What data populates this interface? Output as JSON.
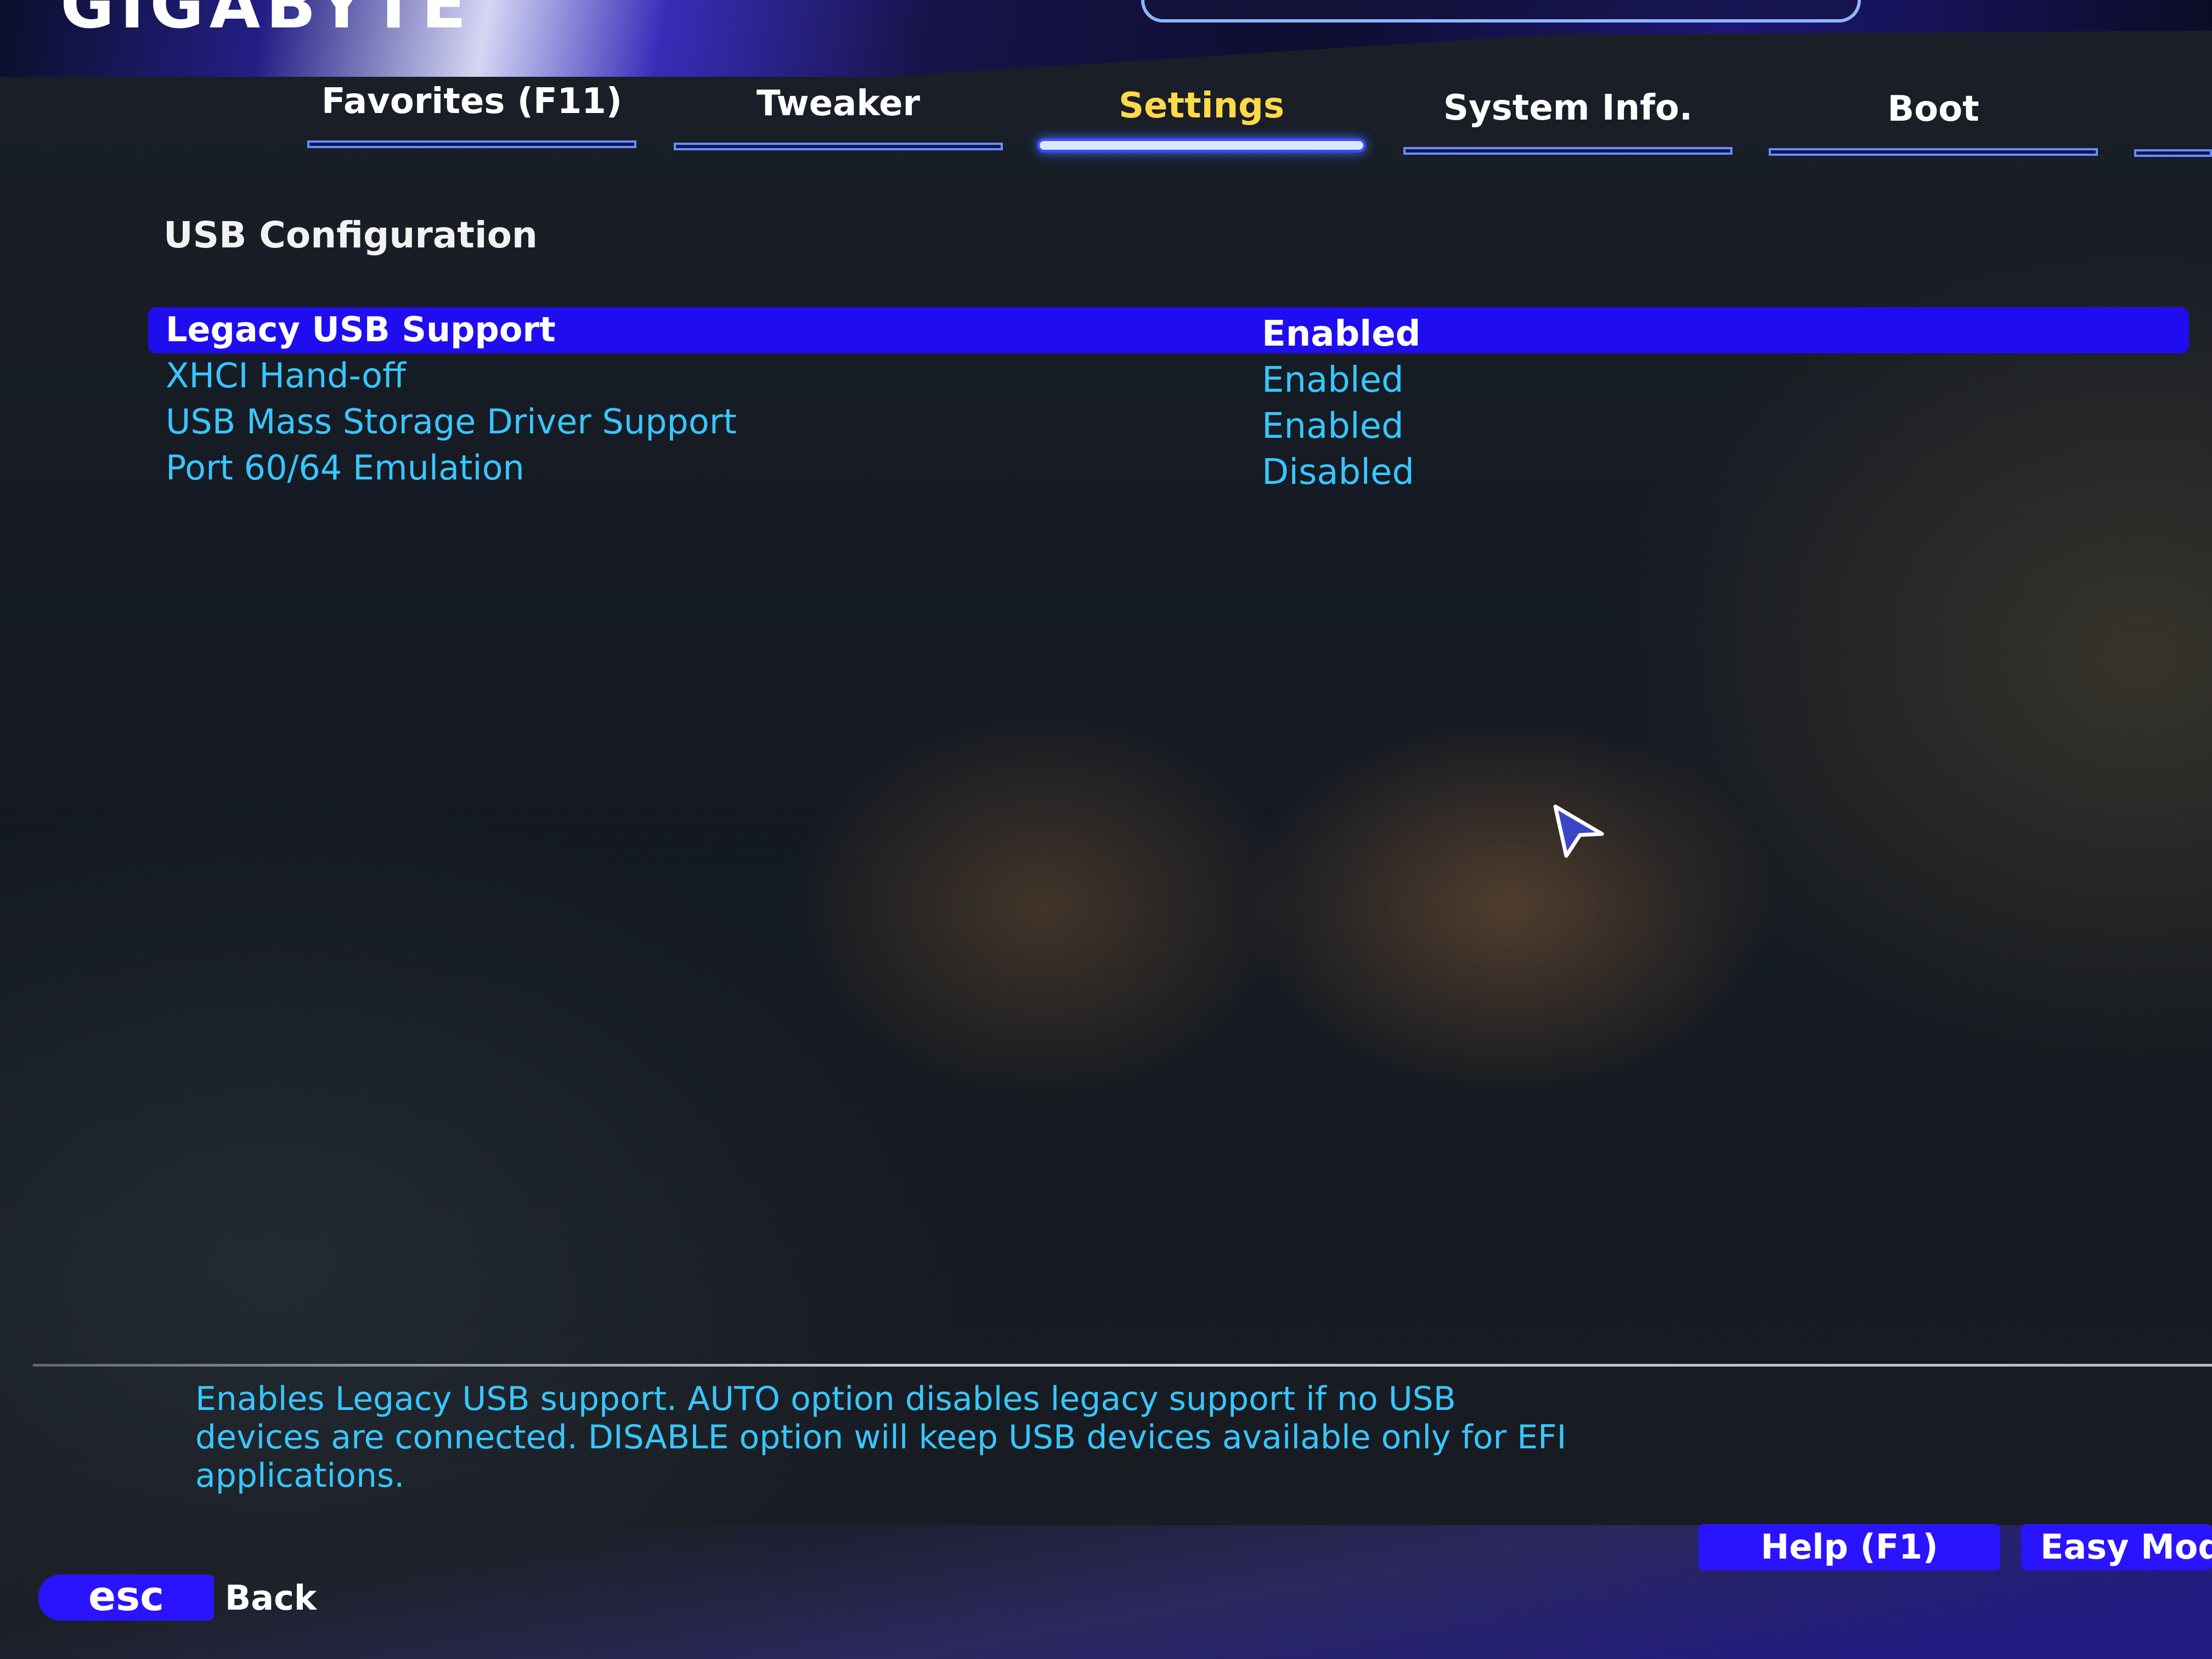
{
  "brand": {
    "name": "GIGABYTE"
  },
  "tabs": [
    {
      "label": "Favorites (F11)",
      "active": false
    },
    {
      "label": "Tweaker",
      "active": false
    },
    {
      "label": "Settings",
      "active": true
    },
    {
      "label": "System Info.",
      "active": false
    },
    {
      "label": "Boot",
      "active": false
    }
  ],
  "section": {
    "title": "USB Configuration"
  },
  "settings": [
    {
      "label": "Legacy USB Support",
      "value": "Enabled",
      "selected": true
    },
    {
      "label": "XHCI Hand-off",
      "value": "Enabled",
      "selected": false
    },
    {
      "label": "USB Mass Storage Driver Support",
      "value": "Enabled",
      "selected": false
    },
    {
      "label": "Port 60/64 Emulation",
      "value": "Disabled",
      "selected": false
    }
  ],
  "help": {
    "text": "Enables Legacy USB support. AUTO option disables legacy support if no USB devices are connected. DISABLE option will keep USB devices available only for EFI applications."
  },
  "footer": {
    "esc_label": "esc",
    "back_label": "Back",
    "help_button": "Help (F1)",
    "easy_mode_button": "Easy Mode"
  },
  "colors": {
    "accent": "#1f0df0",
    "active_tab_text": "#ffd94a",
    "item_text": "#38c6ff"
  }
}
